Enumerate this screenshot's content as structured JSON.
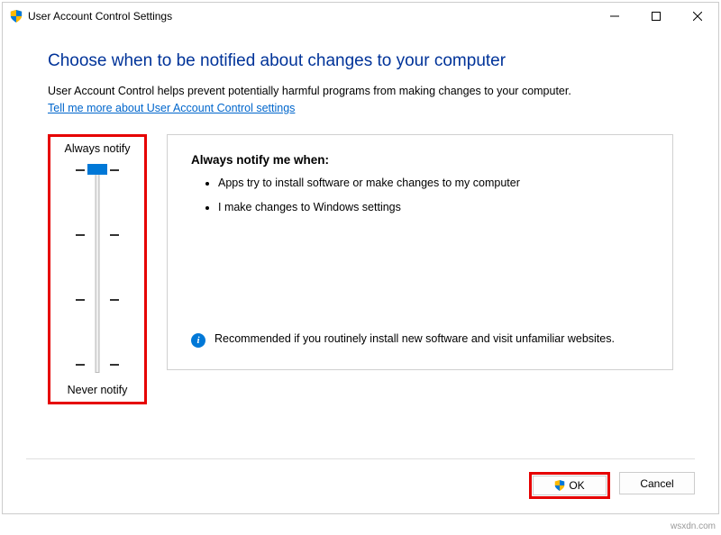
{
  "window": {
    "title": "User Account Control Settings"
  },
  "content": {
    "heading": "Choose when to be notified about changes to your computer",
    "description": "User Account Control helps prevent potentially harmful programs from making changes to your computer.",
    "link": "Tell me more about User Account Control settings"
  },
  "slider": {
    "top_label": "Always notify",
    "bottom_label": "Never notify",
    "position": 0,
    "levels": 4
  },
  "panel": {
    "title": "Always notify me when:",
    "bullets": [
      "Apps try to install software or make changes to my computer",
      "I make changes to Windows settings"
    ],
    "recommendation": "Recommended if you routinely install new software and visit unfamiliar websites."
  },
  "buttons": {
    "ok": "OK",
    "cancel": "Cancel"
  },
  "watermark": "wsxdn.com"
}
